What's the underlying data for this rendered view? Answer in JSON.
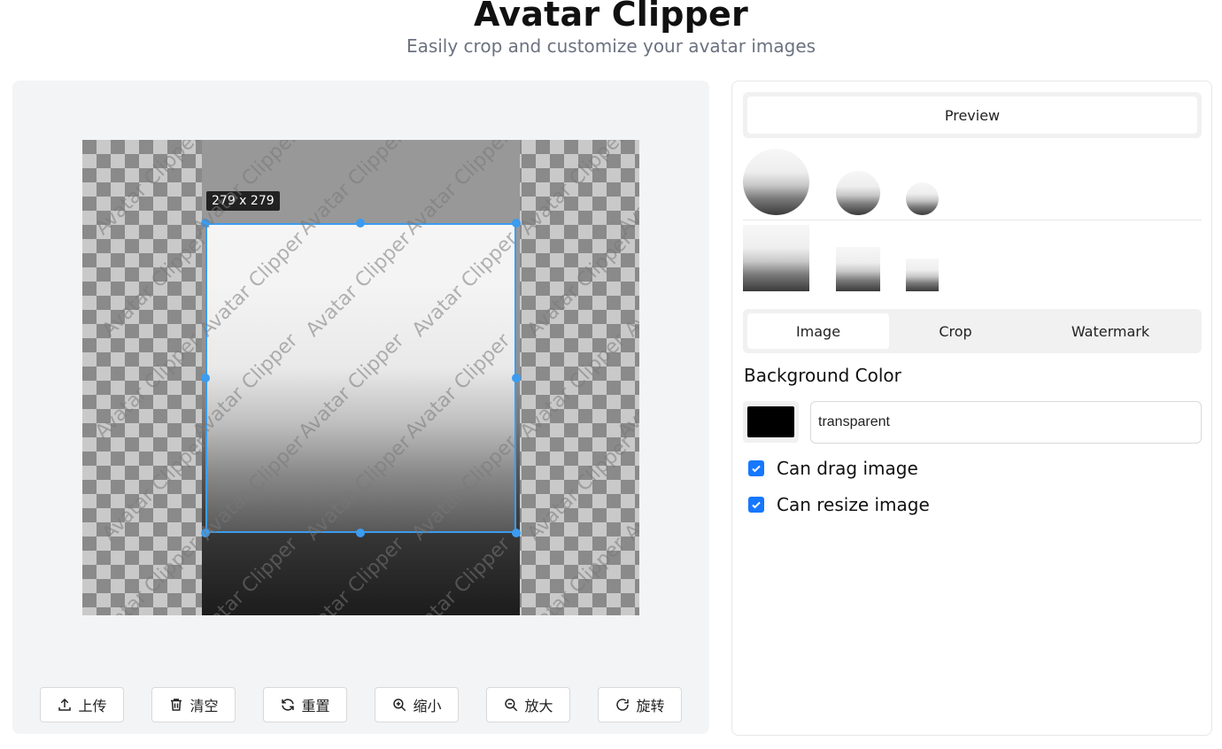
{
  "header": {
    "title": "Avatar Clipper",
    "subtitle": "Easily crop and customize your avatar images"
  },
  "editor": {
    "crop_size_label": "279 x 279",
    "watermark_text": "Avatar Clipper",
    "toolbar": [
      {
        "label": "上传",
        "icon": "upload-icon"
      },
      {
        "label": "清空",
        "icon": "trash-icon"
      },
      {
        "label": "重置",
        "icon": "refresh-icon"
      },
      {
        "label": "缩小",
        "icon": "zoom-in-icon"
      },
      {
        "label": "放大",
        "icon": "zoom-out-icon"
      },
      {
        "label": "旋转",
        "icon": "rotate-icon"
      }
    ],
    "accent": "#3b9cf0"
  },
  "side": {
    "preview_tab": "Preview",
    "tabs": [
      "Image",
      "Crop",
      "Watermark"
    ],
    "active_tab": "Image",
    "background_color_label": "Background Color",
    "background_color_value": "transparent",
    "swatch_color": "#000000",
    "checkboxes": [
      {
        "label": "Can drag image",
        "checked": true
      },
      {
        "label": "Can resize image",
        "checked": true
      }
    ]
  }
}
